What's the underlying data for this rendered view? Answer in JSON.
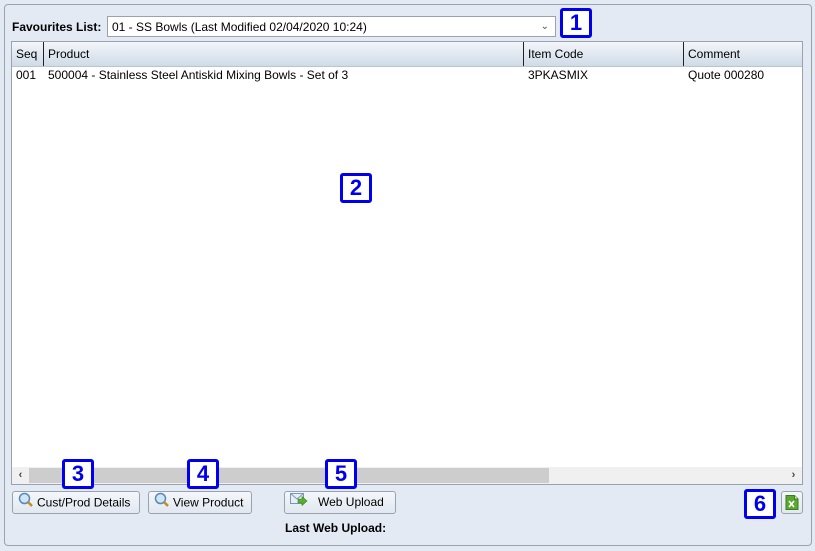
{
  "favourites": {
    "label": "Favourites List:",
    "selected": "01 - SS Bowls (Last Modified 02/04/2020 10:24)",
    "dropdown_icon": "chevron-down-icon"
  },
  "table": {
    "columns": [
      "Seq",
      "Product",
      "Item Code",
      "Comment"
    ],
    "rows": [
      {
        "seq": "001",
        "product": "500004 - Stainless Steel Antiskid Mixing Bowls - Set of 3",
        "item_code": "3PKASMIX",
        "comment": "Quote 000280"
      }
    ]
  },
  "scrollbar": {
    "left_arrow": "‹",
    "right_arrow": "›"
  },
  "buttons": {
    "cust_prod_details": "Cust/Prod Details",
    "view_product": "View Product",
    "web_upload": "Web Upload",
    "export_excel_icon": "excel-icon"
  },
  "last_web_upload_label": "Last Web Upload:",
  "badges": [
    "1",
    "2",
    "3",
    "4",
    "5",
    "6"
  ],
  "colors": {
    "badge": "#0000ee",
    "background": "#e3eaf3",
    "excel_green": "#5aa832"
  }
}
